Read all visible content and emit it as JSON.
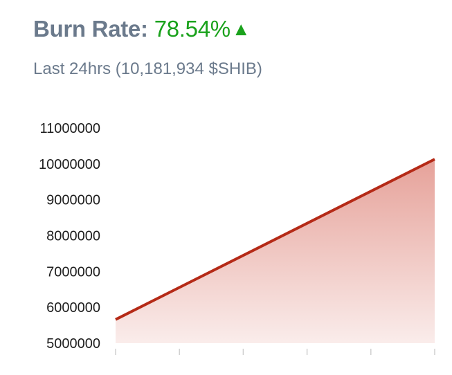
{
  "header": {
    "title_label": "Burn Rate:",
    "title_value": "78.54%",
    "trend_icon": "triangle-up-icon",
    "trend_symbol": "▲",
    "subtitle": "Last 24hrs (10,181,934 $SHIB)"
  },
  "colors": {
    "title_text": "#6b7a8c",
    "positive": "#1aa21c",
    "line": "#b52a17",
    "area": "#e3978e"
  },
  "chart_data": {
    "type": "area",
    "title": "",
    "xlabel": "",
    "ylabel": "",
    "x": [
      0,
      1
    ],
    "values": [
      5660000,
      10130000
    ],
    "ylim": [
      5000000,
      11000000
    ],
    "yticks": [
      "5000000",
      "6000000",
      "7000000",
      "8000000",
      "9000000",
      "10000000",
      "11000000"
    ],
    "xtick_count": 6,
    "grid": false,
    "legend": "none"
  }
}
